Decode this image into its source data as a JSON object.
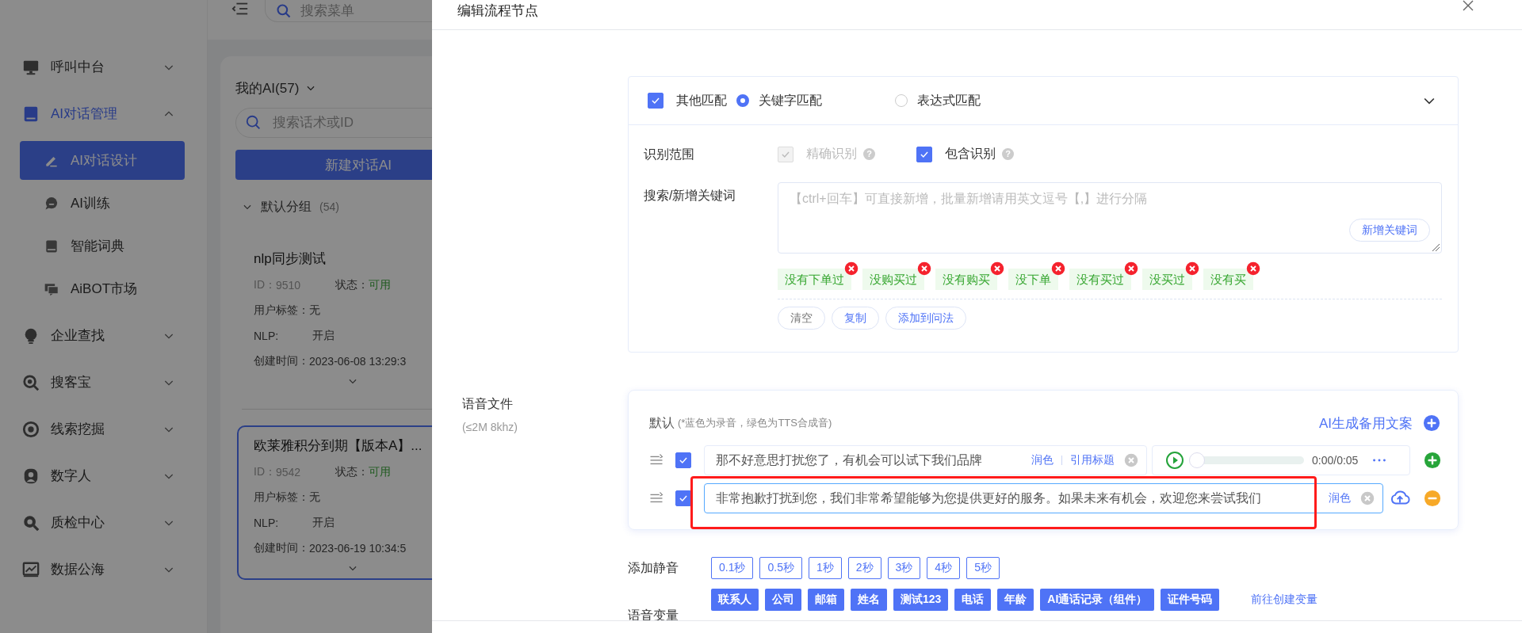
{
  "sidebar": {
    "items": [
      {
        "label": "呼叫中台",
        "expanded": false
      },
      {
        "label": "AI对话管理",
        "expanded": true,
        "children": [
          {
            "label": "AI对话设计",
            "selected": true
          },
          {
            "label": "AI训练",
            "selected": false
          },
          {
            "label": "智能词典",
            "selected": false
          },
          {
            "label": "AiBOT市场",
            "selected": false
          }
        ]
      },
      {
        "label": "企业查找",
        "expanded": false
      },
      {
        "label": "搜客宝",
        "expanded": false
      },
      {
        "label": "线索挖掘",
        "expanded": false
      },
      {
        "label": "数字人",
        "expanded": false
      },
      {
        "label": "质检中心",
        "expanded": false
      },
      {
        "label": "数据公海",
        "expanded": false
      }
    ]
  },
  "topbar": {
    "search": {
      "placeholder": "搜索菜单"
    }
  },
  "ai_list": {
    "title": "我的AI(57)",
    "search": {
      "placeholder": "搜索话术或ID"
    },
    "new_button": "新建对话AI",
    "group": {
      "label": "默认分组",
      "count": "(54)",
      "expanded": true
    },
    "items": [
      {
        "title": "nlp同步测试",
        "id_label": "ID：",
        "id": "9510",
        "status_label": "状态：",
        "status": "可用",
        "tag_label": "用户标签：",
        "tags": "无",
        "nlp_label": "NLP:",
        "nlp": "开启",
        "created_label": "创建时间：",
        "created": "2023-06-08 13:29:3",
        "selected": false
      },
      {
        "title": "欧莱雅积分到期【版本A】...",
        "id_label": "ID：",
        "id": "9542",
        "status_label": "状态：",
        "status": "可用",
        "tag_label": "用户标签：",
        "tags": "无",
        "nlp_label": "NLP:",
        "nlp": "开启",
        "created_label": "创建时间：",
        "created": "2023-06-19 10:34:5",
        "selected": true
      }
    ]
  },
  "drawer": {
    "title": "编辑流程节点",
    "match": {
      "options": [
        {
          "kind": "checkbox",
          "label": "其他匹配",
          "checked": true
        },
        {
          "kind": "radio",
          "label": "关键字匹配",
          "selected": true
        },
        {
          "kind": "radio",
          "label": "表达式匹配",
          "selected": false
        }
      ],
      "scope": {
        "label": "识别范围",
        "options": [
          {
            "label": "精确识别",
            "checked": true,
            "disabled": true,
            "help": "?"
          },
          {
            "label": "包含识别",
            "checked": true,
            "disabled": false,
            "help": "?"
          }
        ]
      },
      "keywords": {
        "label": "搜索/新增关键词",
        "placeholder": "【ctrl+回车】可直接新增，批量新增请用英文逗号【,】进行分隔",
        "add_button": "新增关键词",
        "tags": [
          "没有下单过",
          "没购买过",
          "没有购买",
          "没下单",
          "没有买过",
          "没买过",
          "没有买"
        ],
        "actions": [
          {
            "label": "清空",
            "kind": "neutral"
          },
          {
            "label": "复制",
            "kind": "primary"
          },
          {
            "label": "添加到问法",
            "kind": "primary"
          }
        ]
      }
    },
    "voice": {
      "label": "语音文件",
      "hint": "(≤2M 8khz)",
      "group": "默认",
      "note": "(*蓝色为录音，绿色为TTS合成音)",
      "generate_link": "AI生成备用文案",
      "rows": [
        {
          "kind": "audio",
          "checked": true,
          "focused": false,
          "text": "那不好意思打扰您了，有机会可以试下我们品牌",
          "actions": [
            "润色",
            "引用标题"
          ],
          "audio": {
            "time": "0:00/0:05",
            "level": 0
          },
          "end_button": {
            "kind": "add"
          }
        },
        {
          "kind": "upload",
          "checked": true,
          "focused": true,
          "text": "非常抱歉打扰到您，我们非常希望能够为您提供更好的服务。如果未来有机会，欢迎您来尝试我们",
          "actions": [
            "润色"
          ],
          "end_button": {
            "kind": "remove"
          },
          "highlighted": true
        }
      ]
    },
    "silence": {
      "label": "添加静音",
      "options": [
        "0.1秒",
        "0.5秒",
        "1秒",
        "2秒",
        "3秒",
        "4秒",
        "5秒"
      ]
    },
    "variables": {
      "label": "语音变量",
      "tags": [
        "联系人",
        "公司",
        "邮箱",
        "姓名",
        "测试123",
        "电话",
        "年龄",
        "AI通话记录（组件）",
        "证件号码"
      ],
      "create_link": "前往创建变量"
    }
  }
}
